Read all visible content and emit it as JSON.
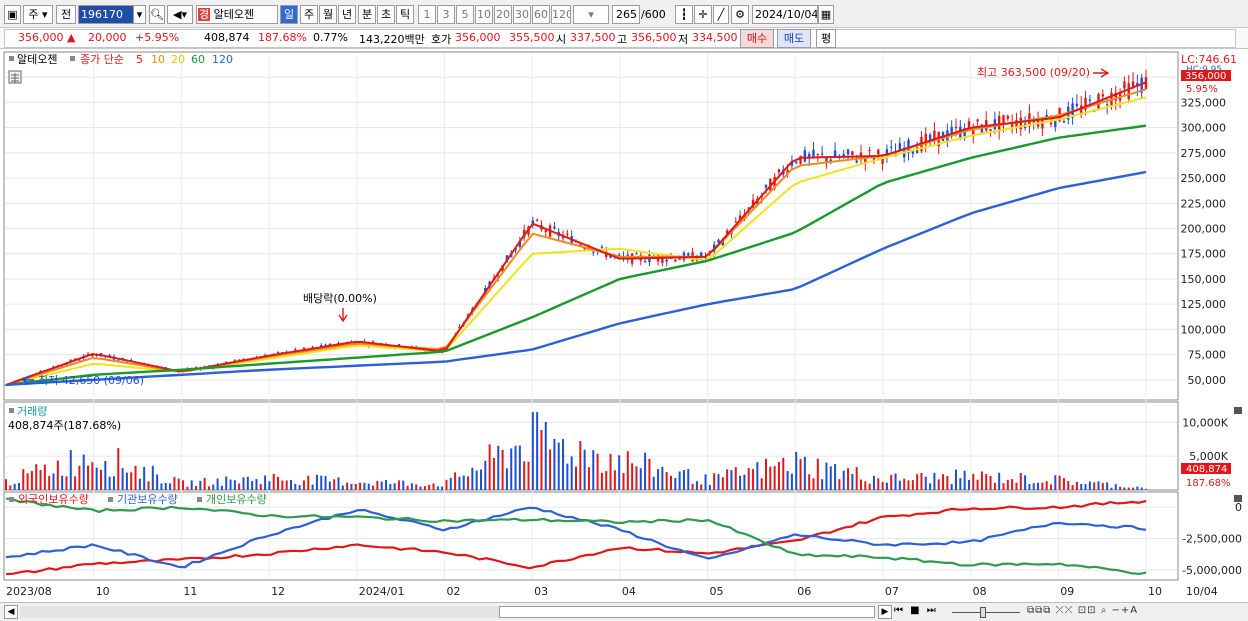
{
  "toolbar": {
    "market": "주",
    "prev_label": "전",
    "code": "196170",
    "stock_name_badge": "경",
    "stock_name": "알테오젠",
    "periods": [
      "일",
      "주",
      "월",
      "년",
      "분",
      "초",
      "틱"
    ],
    "active_period": "일",
    "intervals": [
      "1",
      "3",
      "5",
      "10",
      "20",
      "30",
      "60",
      "120"
    ],
    "bar_count": "265",
    "bar_total": "/600",
    "date": "2024/10/04"
  },
  "quote": {
    "price": "356,000",
    "change": "20,000",
    "change_pct": "+5.95%",
    "volume": "408,874",
    "volume_ratio": "187.68%",
    "turnover_pct": "0.77%",
    "amount": "143,220백만",
    "ask_label": "호가",
    "ask_a": "356,000",
    "ask_b": "355,500",
    "open_label": "시",
    "open": "337,500",
    "high_label": "고",
    "high": "356,500",
    "low_label": "저",
    "low": "334,500",
    "buy_label": "매수",
    "sell_label": "매도",
    "eval_label": "평"
  },
  "price_panel": {
    "legend_name": "알테오젠",
    "legend_ma_label": "종가 단순",
    "ma_periods": [
      "5",
      "10",
      "20",
      "60",
      "120"
    ],
    "lc": "LC:746.61",
    "hc": "HC:9.95",
    "last_price": "356,000",
    "last_change": "5.95%",
    "high_note": "최고 363,500 (09/20)",
    "low_note": "최저 42,650 (09/06)",
    "dividend_note": "배당락(0.00%)"
  },
  "volume_panel": {
    "title": "거래량",
    "value": "408,874주(187.68%)",
    "last_value": "408,874",
    "last_ratio": "187.68%"
  },
  "holders_panel": {
    "series_names": [
      "외국인보유수량",
      "기관보유수량",
      "개인보유수량"
    ]
  },
  "x_axis": {
    "labels": [
      "2023/08",
      "10",
      "11",
      "12",
      "2024/01",
      "02",
      "03",
      "04",
      "05",
      "06",
      "07",
      "08",
      "09",
      "10",
      "10/04"
    ]
  },
  "colors": {
    "ma5": "#e01818",
    "ma10": "#f08a1c",
    "ma20": "#f2e21a",
    "ma60": "#1a9a2e",
    "ma120": "#2d5fd8",
    "up": "#e01818",
    "down": "#1a4fd6",
    "foreign": "#e01818",
    "institution": "#2d5fd8",
    "individual": "#2e9a50"
  },
  "chart_data": [
    {
      "type": "line",
      "title": "",
      "x": [
        "2023/08",
        "10",
        "11",
        "12",
        "2024/01",
        "02",
        "03",
        "04",
        "05",
        "06",
        "07",
        "08",
        "09",
        "10"
      ],
      "ylim": [
        30000,
        375000
      ],
      "y_ticks": [
        50000,
        75000,
        100000,
        125000,
        150000,
        175000,
        200000,
        225000,
        250000,
        275000,
        300000,
        325000,
        350000
      ],
      "series": [
        {
          "name": "5",
          "values": [
            45000,
            76000,
            58000,
            74000,
            88000,
            78000,
            205000,
            170000,
            172000,
            270000,
            272000,
            300000,
            310000,
            345000
          ]
        },
        {
          "name": "10",
          "values": [
            45000,
            72000,
            58000,
            73000,
            86000,
            80000,
            195000,
            172000,
            172000,
            262000,
            272000,
            298000,
            312000,
            338000
          ]
        },
        {
          "name": "20",
          "values": [
            45000,
            66000,
            58000,
            71000,
            84000,
            78000,
            175000,
            180000,
            168000,
            245000,
            270000,
            292000,
            308000,
            330000
          ]
        },
        {
          "name": "60",
          "values": [
            45000,
            55000,
            60000,
            66000,
            72000,
            78000,
            112000,
            150000,
            168000,
            196000,
            245000,
            270000,
            290000,
            302000
          ]
        },
        {
          "name": "120",
          "values": [
            45000,
            50000,
            55000,
            60000,
            64000,
            68000,
            80000,
            106000,
            125000,
            140000,
            180000,
            215000,
            240000,
            256000
          ]
        }
      ]
    },
    {
      "type": "bar",
      "title": "",
      "ylim": [
        0,
        13000000
      ],
      "y_ticks": [
        5000000,
        10000000
      ],
      "y_tick_labels": [
        "5,000K",
        "10,000K"
      ],
      "x": [
        "2023/08",
        "10",
        "11",
        "12",
        "2024/01",
        "02",
        "03",
        "04",
        "05",
        "06",
        "07",
        "08",
        "09",
        "10"
      ],
      "values": [
        1500000,
        6500000,
        1200000,
        2200000,
        1500000,
        1100000,
        9500000,
        5500000,
        1800000,
        5000000,
        2000000,
        2500000,
        1800000,
        408874
      ]
    },
    {
      "type": "line",
      "title": "",
      "ylim": [
        -5800000,
        1200000
      ],
      "y_ticks": [
        0,
        -2500000,
        -5000000
      ],
      "y_tick_labels": [
        "0",
        "-2,500,000",
        "-5,000,000"
      ],
      "x": [
        "2023/08",
        "10",
        "11",
        "12",
        "2024/01",
        "02",
        "03",
        "04",
        "05",
        "06",
        "07",
        "08",
        "09",
        "10"
      ],
      "series": [
        {
          "name": "외국인보유수량",
          "values": [
            -5400000,
            -4500000,
            -4200000,
            -3700000,
            -3000000,
            -3600000,
            -4800000,
            -3200000,
            -3700000,
            -2700000,
            -800000,
            -100000,
            0,
            500000
          ]
        },
        {
          "name": "기관보유수량",
          "values": [
            -4000000,
            -3000000,
            -4800000,
            -2200000,
            -200000,
            -1800000,
            0,
            -1800000,
            -4200000,
            -2200000,
            -3000000,
            -2800000,
            -1200000,
            -1700000
          ]
        },
        {
          "name": "개인보유수량",
          "values": [
            600000,
            -300000,
            0,
            -700000,
            -800000,
            -1100000,
            -1000000,
            -1200000,
            -1000000,
            -3800000,
            -4000000,
            -4600000,
            -4500000,
            -5300000
          ]
        }
      ]
    }
  ]
}
